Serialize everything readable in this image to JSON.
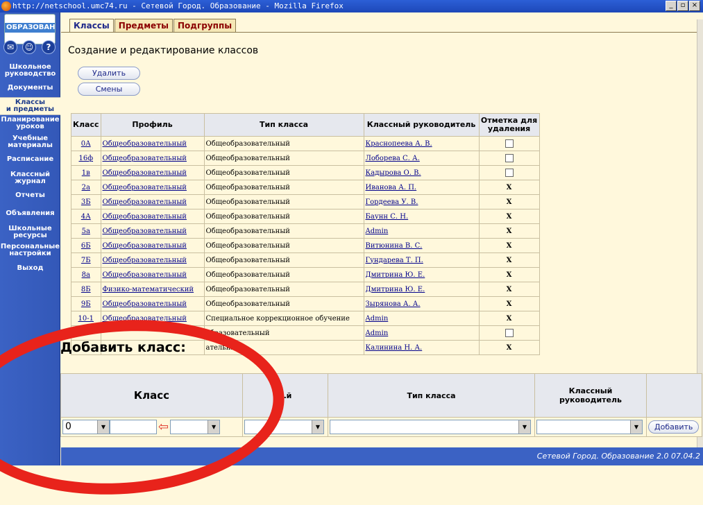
{
  "window": {
    "title": "http://netschool.umc74.ru - Сетевой Город. Образование - Mozilla Firefox"
  },
  "sidebar": {
    "logo_text": "ОБРАЗОВАНИ",
    "icons": [
      "mail-icon",
      "users-icon",
      "help-icon"
    ],
    "help_glyph": "?",
    "mail_glyph": "✉",
    "users_glyph": "☺",
    "items": [
      {
        "line1": "Школьное",
        "line2": "руководство"
      },
      {
        "line1": "Документы",
        "line2": ""
      },
      {
        "line1": "Классы",
        "line2": "и предметы"
      },
      {
        "line1": "Планирование",
        "line2": "уроков"
      },
      {
        "line1": "Учебные",
        "line2": "материалы"
      },
      {
        "line1": "Расписание",
        "line2": ""
      },
      {
        "line1": "Классный",
        "line2": "журнал"
      },
      {
        "line1": "Отчеты",
        "line2": ""
      },
      {
        "line1": "Объявления",
        "line2": ""
      },
      {
        "line1": "Школьные",
        "line2": "ресурсы"
      },
      {
        "line1": "Персональные",
        "line2": "настройки"
      },
      {
        "line1": "Выход",
        "line2": ""
      }
    ],
    "active_index": 2
  },
  "tabs": [
    {
      "label": "Классы",
      "active": true
    },
    {
      "label": "Предметы",
      "active": false
    },
    {
      "label": "Подгруппы",
      "active": false
    }
  ],
  "page": {
    "title": "Создание и редактирование классов",
    "delete_button": "Удалить",
    "shifts_button": "Смены"
  },
  "table": {
    "headers": {
      "class": "Класс",
      "profile": "Профиль",
      "type": "Тип класса",
      "teacher": "Классный руководитель",
      "mark_line1": "Отметка для",
      "mark_line2": "удаления"
    },
    "rows": [
      {
        "class": "0А",
        "profile": "Общеобразовательный",
        "type": "Общеобразовательный",
        "teacher": "Краснопеева А. В.",
        "mark": "checkbox"
      },
      {
        "class": "16ф",
        "profile": "Общеобразовательный",
        "type": "Общеобразовательный",
        "teacher": "Лоборева С. А.",
        "mark": "checkbox"
      },
      {
        "class": "1в",
        "profile": "Общеобразовательный",
        "type": "Общеобразовательный",
        "teacher": "Кадырова О. В.",
        "mark": "checkbox"
      },
      {
        "class": "2а",
        "profile": "Общеобразовательный",
        "type": "Общеобразовательный",
        "teacher": "Иванова А. П.",
        "mark": "X"
      },
      {
        "class": "3Б",
        "profile": "Общеобразовательный",
        "type": "Общеобразовательный",
        "teacher": "Гордеева У. В.",
        "mark": "X"
      },
      {
        "class": "4А",
        "profile": "Общеобразовательный",
        "type": "Общеобразовательный",
        "teacher": "Баунн С. Н.",
        "mark": "X"
      },
      {
        "class": "5а",
        "profile": "Общеобразовательный",
        "type": "Общеобразовательный",
        "teacher": "Admin",
        "mark": "X"
      },
      {
        "class": "6Б",
        "profile": "Общеобразовательный",
        "type": "Общеобразовательный",
        "teacher": "Витюнина В. С.",
        "mark": "X"
      },
      {
        "class": "7Б",
        "profile": "Общеобразовательный",
        "type": "Общеобразовательный",
        "teacher": "Гундарева Т. П.",
        "mark": "X"
      },
      {
        "class": "8а",
        "profile": "Общеобразовательный",
        "type": "Общеобразовательный",
        "teacher": "Дмитрина Ю. Е.",
        "mark": "X"
      },
      {
        "class": "8Б",
        "profile": "Физико-математический",
        "type": "Общеобразовательный",
        "teacher": "Дмитрина Ю. Е.",
        "mark": "X"
      },
      {
        "class": "9Б",
        "profile": "Общеобразовательный",
        "type": "Общеобразовательный",
        "teacher": "Зырянова А. А.",
        "mark": "X"
      },
      {
        "class": "10-1",
        "profile": "Общеобразовательный",
        "type": "Специальное коррекционное обучение",
        "teacher": "Admin",
        "mark": "X"
      },
      {
        "class": "",
        "profile": "",
        "type": "образовательный",
        "teacher": "Admin",
        "mark": "checkbox"
      },
      {
        "class": "",
        "profile": "",
        "type": "ательный",
        "teacher": "Калинина Н. А.",
        "mark": "X"
      }
    ]
  },
  "add_form": {
    "title": "Добавить класс:",
    "headers": {
      "class": "Класс",
      "profile": "…й",
      "type": "Тип класса",
      "teacher_line1": "Классный",
      "teacher_line2": "руководитель"
    },
    "grade_value": "0",
    "add_button": "Добавить"
  },
  "footer": {
    "text": "Сетевой Город. Образование 2.0    07.04.2"
  },
  "colors": {
    "sidebar": "#3b62c4",
    "page_bg": "#fff8dc",
    "link": "#00008b",
    "annotation": "#e8231b"
  }
}
